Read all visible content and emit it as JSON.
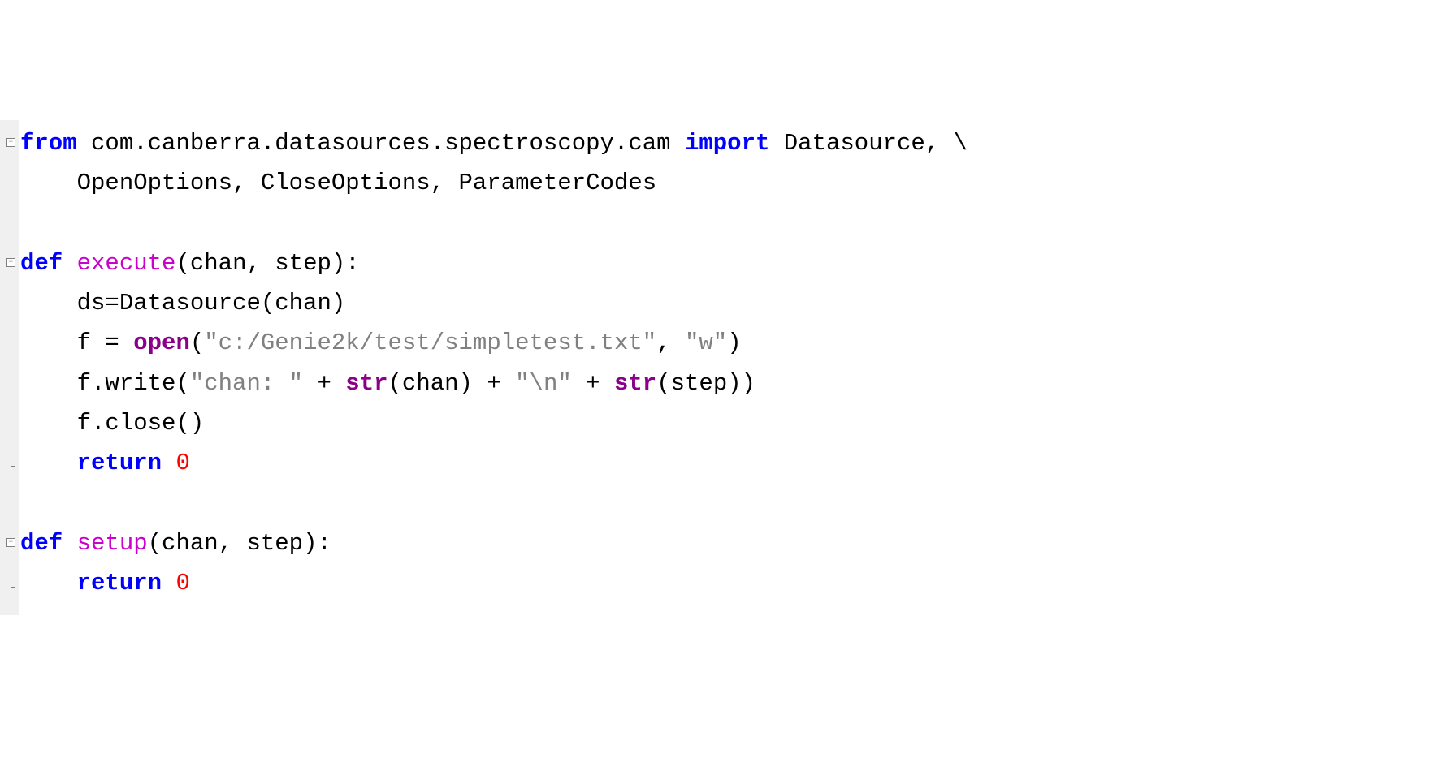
{
  "code": {
    "from": "from",
    "import_path": " com.canberra.datasources.spectroscopy.cam ",
    "import": "import",
    "import_tail": " Datasource, \\",
    "line2": "    OpenOptions, CloseOptions, ParameterCodes",
    "def1": "def",
    "exec_name": " execute",
    "exec_params": "(chan, step):",
    "ds_line": "    ds=Datasource(chan)",
    "f_assign": "    f = ",
    "open_kw": "open",
    "open_paren": "(",
    "str1": "\"c:/Genie2k/test/simpletest.txt\"",
    "comma1": ", ",
    "str2": "\"w\"",
    "close_paren1": ")",
    "fwrite_pre": "    f.write(",
    "str3": "\"chan: \"",
    "plus1": " + ",
    "str_kw1": "str",
    "str_arg1": "(chan) + ",
    "str4": "\"\\n\"",
    "plus2": " + ",
    "str_kw2": "str",
    "str_arg2": "(step))",
    "fclose": "    f.close()",
    "ret1_pre": "    ",
    "return": "return",
    "ret1_val": " ",
    "zero": "0",
    "def2": "def",
    "setup_name": " setup",
    "setup_params": "(chan, step):",
    "ret2_pre": "    ",
    "return2": "return",
    "ret2_val": " ",
    "zero2": "0"
  }
}
